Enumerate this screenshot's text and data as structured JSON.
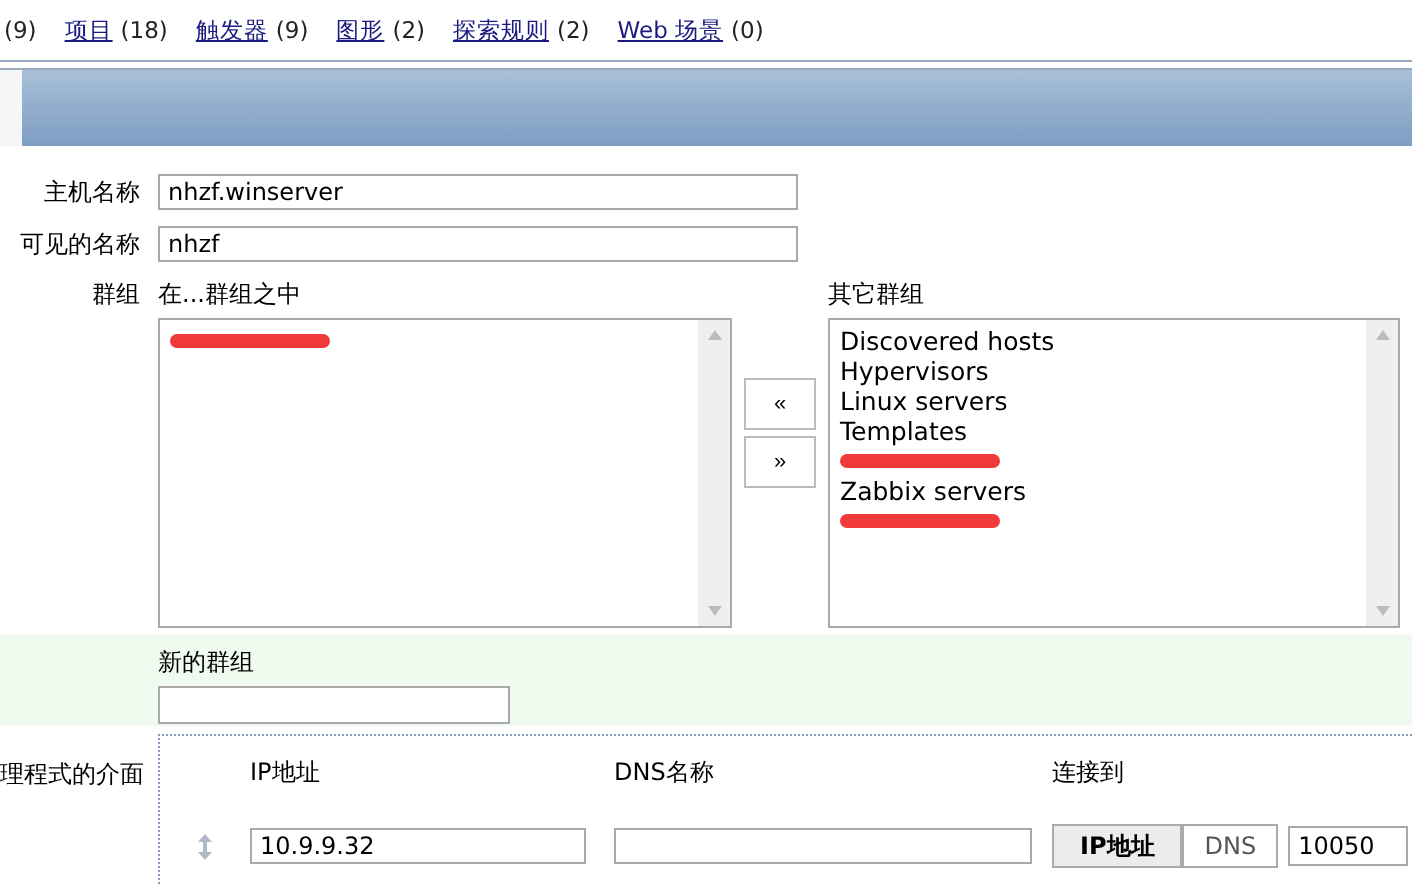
{
  "top_links": [
    {
      "count": "(9)"
    },
    {
      "label": "项目",
      "count": "(18)"
    },
    {
      "label": "触发器",
      "count": "(9)"
    },
    {
      "label": "图形",
      "count": "(2)"
    },
    {
      "label": "探索规则",
      "count": "(2)"
    },
    {
      "label": "Web 场景",
      "count": "(0)"
    }
  ],
  "form": {
    "host_name": {
      "label": "主机名称",
      "value": "nhzf.winserver"
    },
    "visible_name": {
      "label": "可见的名称",
      "value": "nhzf"
    },
    "groups": {
      "label": "群组",
      "in_groups_title": "在...群组之中",
      "in_groups": [
        {
          "kind": "redacted"
        }
      ],
      "move_buttons": [
        "«",
        "»"
      ],
      "other_groups_title": "其它群组",
      "other_groups": [
        {
          "kind": "text",
          "label": "Discovered hosts"
        },
        {
          "kind": "text",
          "label": "Hypervisors"
        },
        {
          "kind": "text",
          "label": "Linux servers"
        },
        {
          "kind": "text",
          "label": "Templates"
        },
        {
          "kind": "redacted"
        },
        {
          "kind": "text",
          "label": "Zabbix servers"
        },
        {
          "kind": "redacted"
        }
      ]
    },
    "new_group": {
      "label": "新的群组"
    },
    "agent_interfaces": {
      "label": "理程式的介面",
      "columns": [
        "IP地址",
        "DNS名称",
        "连接到"
      ],
      "rows": [
        {
          "ip": "10.9.9.32",
          "connect": [
            {
              "label": "IP地址",
              "selected": true
            },
            {
              "label": "DNS",
              "selected": false
            }
          ],
          "port": "10050"
        }
      ]
    }
  }
}
